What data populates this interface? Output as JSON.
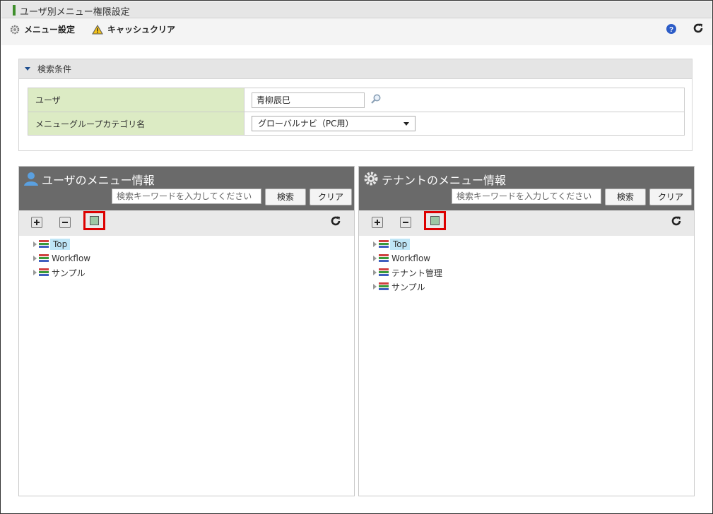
{
  "app": {
    "title": "ユーザ別メニュー権限設定"
  },
  "toolbar": {
    "menu_settings": "メニュー設定",
    "cache_clear": "キャッシュクリア"
  },
  "search": {
    "header": "検索条件",
    "user_label": "ユーザ",
    "user_value": "青柳辰巳",
    "category_label": "メニューグループカテゴリ名",
    "category_value": "グローバルナビ（PC用）"
  },
  "panels": [
    {
      "title": "ユーザのメニュー情報",
      "keyword_placeholder": "検索キーワードを入力してください",
      "search_button": "検索",
      "clear_button": "クリア",
      "tree": [
        "Top",
        "Workflow",
        "サンプル"
      ]
    },
    {
      "title": "テナントのメニュー情報",
      "keyword_placeholder": "検索キーワードを入力してください",
      "search_button": "検索",
      "clear_button": "クリア",
      "tree": [
        "Top",
        "Workflow",
        "テナント管理",
        "サンプル"
      ]
    }
  ],
  "colors": {
    "accent_green": "#3f8f2c",
    "header_gray": "#6a6a6a",
    "label_bg": "#dcebc4",
    "highlight": "#d00000"
  }
}
